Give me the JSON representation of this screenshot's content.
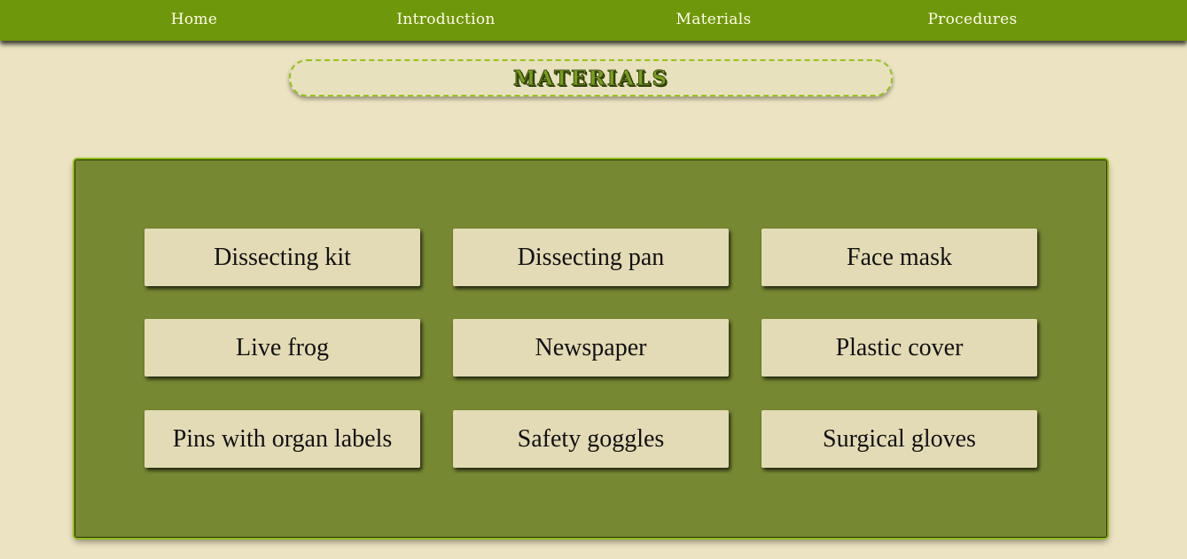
{
  "nav": {
    "items": [
      {
        "label": "Home"
      },
      {
        "label": "Introduction"
      },
      {
        "label": "Materials"
      },
      {
        "label": "Procedures"
      }
    ]
  },
  "page": {
    "title": "Materials"
  },
  "materials": {
    "items": [
      {
        "label": "Dissecting kit"
      },
      {
        "label": "Dissecting pan"
      },
      {
        "label": "Face mask"
      },
      {
        "label": "Live frog"
      },
      {
        "label": "Newspaper"
      },
      {
        "label": "Plastic cover"
      },
      {
        "label": "Pins with organ labels"
      },
      {
        "label": "Safety goggles"
      },
      {
        "label": "Surgical gloves"
      }
    ]
  },
  "colors": {
    "navbar": "#6e970b",
    "background": "#ebe3c1",
    "panel": "#778832",
    "card": "#e3dbb5",
    "title_accent": "#78a01e"
  }
}
